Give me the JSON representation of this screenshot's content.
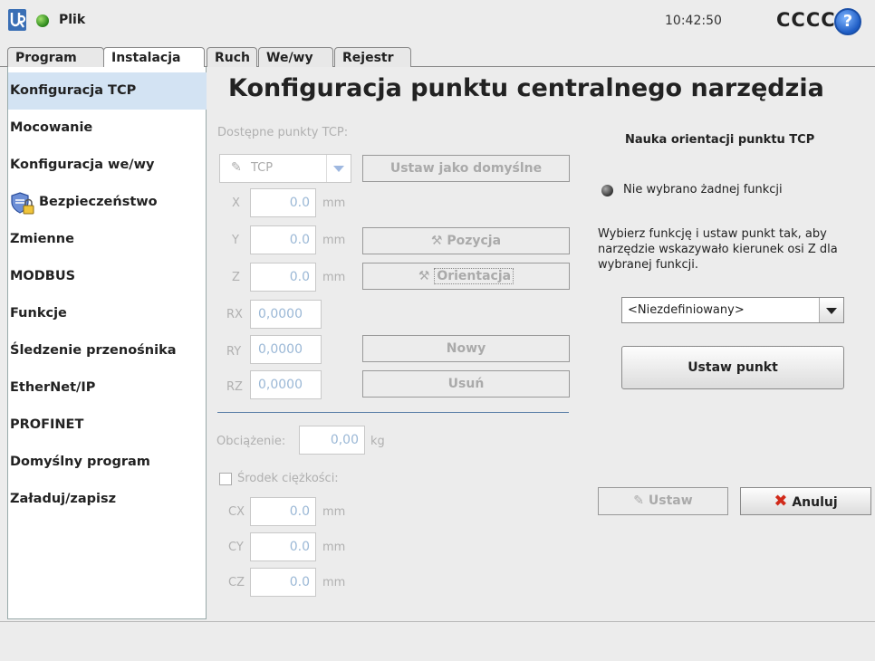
{
  "header": {
    "file_label": "Plik",
    "clock": "10:42:50",
    "robot_name": "CCCC",
    "help_glyph": "?"
  },
  "tabs": [
    {
      "label": "Program"
    },
    {
      "label": "Instalacja"
    },
    {
      "label": "Ruch"
    },
    {
      "label": "We/wy"
    },
    {
      "label": "Rejestr"
    }
  ],
  "active_tab": "Instalacja",
  "sidebar": {
    "items": [
      {
        "label": "Konfiguracja TCP"
      },
      {
        "label": "Mocowanie"
      },
      {
        "label": "Konfiguracja we/wy"
      },
      {
        "label": "Bezpieczeństwo"
      },
      {
        "label": "Zmienne"
      },
      {
        "label": "MODBUS"
      },
      {
        "label": "Funkcje"
      },
      {
        "label": "Śledzenie przenośnika"
      },
      {
        "label": "EtherNet/IP"
      },
      {
        "label": "PROFINET"
      },
      {
        "label": "Domyślny program"
      },
      {
        "label": "Załaduj/zapisz"
      }
    ]
  },
  "main": {
    "title": "Konfiguracja punktu centralnego narzędzia",
    "available_tcp_label": "Dostępne punkty TCP:",
    "tcp_select_value": "TCP",
    "set_default_button": "Ustaw jako domyślne",
    "coords": [
      {
        "label": "X",
        "value": "0.0",
        "unit": "mm"
      },
      {
        "label": "Y",
        "value": "0.0",
        "unit": "mm"
      },
      {
        "label": "Z",
        "value": "0.0",
        "unit": "mm"
      },
      {
        "label": "RX",
        "value": "0,0000",
        "unit": ""
      },
      {
        "label": "RY",
        "value": "0,0000",
        "unit": ""
      },
      {
        "label": "RZ",
        "value": "0,0000",
        "unit": ""
      }
    ],
    "position_button": "Pozycja",
    "orientation_button": "Orientacja",
    "new_button": "Nowy",
    "delete_button": "Usuń",
    "payload_label": "Obciążenie:",
    "payload_value": "0,00",
    "payload_unit": "kg",
    "cog_label": "Środek ciężkości:",
    "cog": [
      {
        "label": "CX",
        "value": "0.0",
        "unit": "mm"
      },
      {
        "label": "CY",
        "value": "0.0",
        "unit": "mm"
      },
      {
        "label": "CZ",
        "value": "0.0",
        "unit": "mm"
      }
    ]
  },
  "right_panel": {
    "heading": "Nauka orientacji punktu TCP",
    "status": "Nie wybrano żadnej funkcji",
    "instructions": "Wybierz funkcję i ustaw punkt tak, aby narzędzie wskazywało kierunek osi Z dla wybranej funkcji.",
    "feature_select_value": "<Niezdefiniowany>",
    "set_point_button": "Ustaw punkt",
    "apply_button": "Ustaw",
    "cancel_button": "Anuluj"
  },
  "colors": {
    "active_sidebar": "#d3e3f3",
    "status_green": "#2f8a1e",
    "cancel_red": "#d12a1a",
    "help_blue": "#1e5cc4"
  }
}
